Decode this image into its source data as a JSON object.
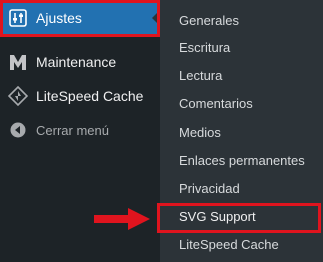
{
  "sidebar": {
    "items": [
      {
        "label": "Ajustes",
        "icon": "settings-sliders-icon",
        "active": true
      },
      {
        "label": "Maintenance",
        "icon": "maintenance-m-icon"
      },
      {
        "label": "LiteSpeed Cache",
        "icon": "litespeed-diamond-icon"
      },
      {
        "label": "Cerrar menú",
        "icon": "collapse-arrow-icon"
      }
    ]
  },
  "submenu": {
    "items": [
      {
        "label": "Generales"
      },
      {
        "label": "Escritura"
      },
      {
        "label": "Lectura"
      },
      {
        "label": "Comentarios"
      },
      {
        "label": "Medios"
      },
      {
        "label": "Enlaces permanentes"
      },
      {
        "label": "Privacidad"
      },
      {
        "label": "SVG Support",
        "highlighted": true
      },
      {
        "label": "LiteSpeed Cache"
      }
    ]
  },
  "colors": {
    "sidebar_bg": "#1d2327",
    "submenu_bg": "#2c3338",
    "active_bg": "#2271b1",
    "highlight_red": "#e0141e"
  }
}
